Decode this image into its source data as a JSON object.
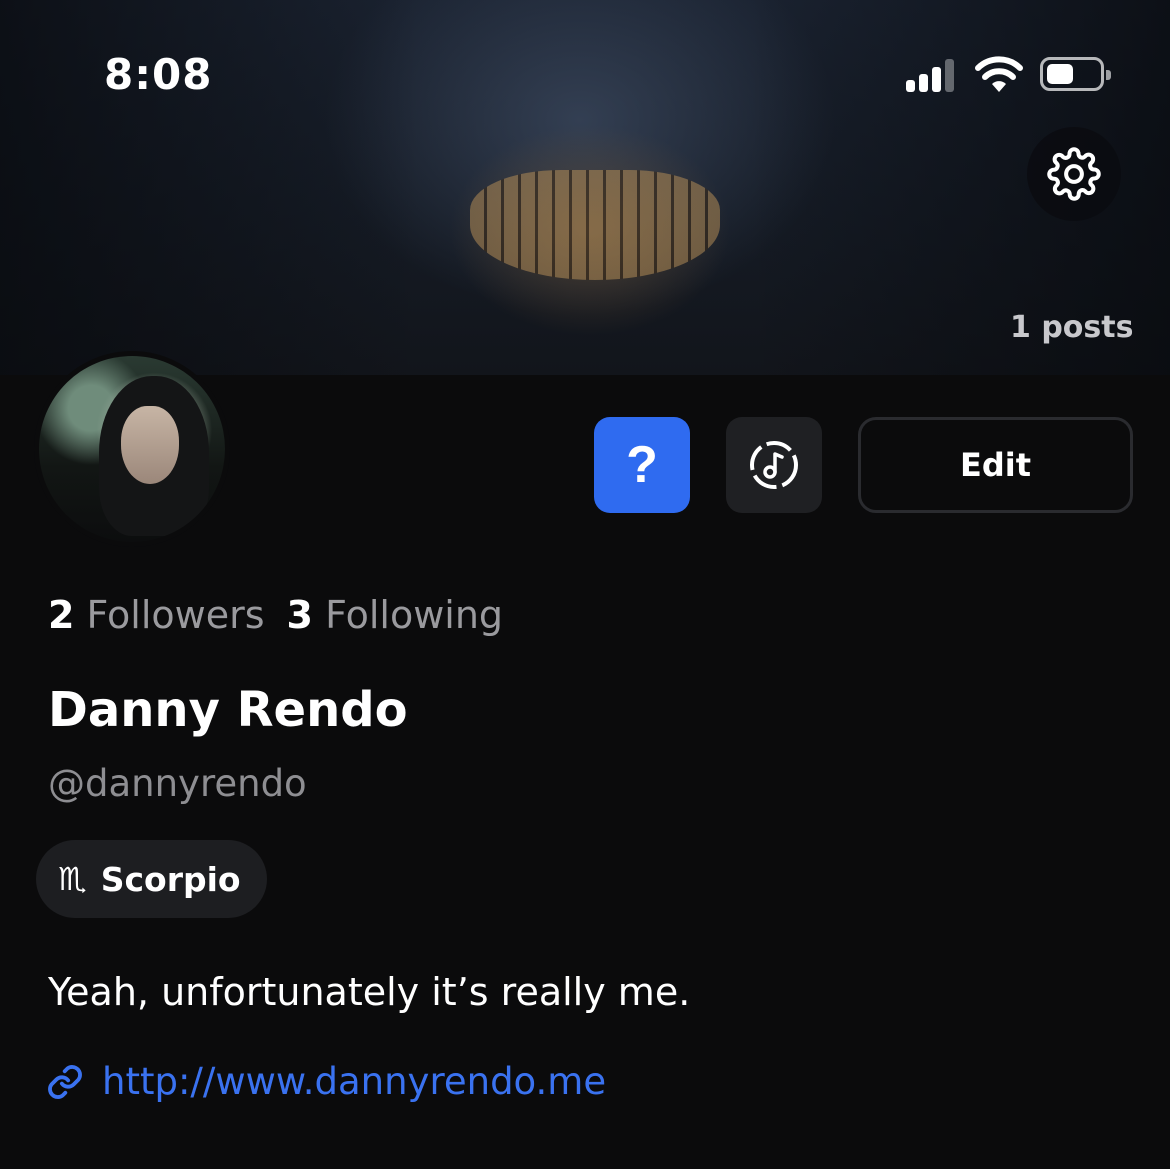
{
  "status_bar": {
    "time": "8:08"
  },
  "header": {
    "posts_count": "1 posts"
  },
  "actions": {
    "help_label": "?",
    "edit_label": "Edit"
  },
  "stats": {
    "followers_count": "2",
    "followers_label": "Followers",
    "following_count": "3",
    "following_label": "Following"
  },
  "profile": {
    "display_name": "Danny Rendo",
    "handle": "@dannyrendo",
    "zodiac_symbol": "♏",
    "zodiac_label": "Scorpio",
    "bio": "Yeah, unfortunately it’s really me.",
    "link": "http://www.dannyrendo.me"
  },
  "colors": {
    "accent": "#2f6bf0",
    "link": "#3a72f0",
    "background": "#0b0b0c"
  },
  "icons": [
    "gear-icon",
    "question-icon",
    "music-icon",
    "link-icon",
    "cellular-signal-icon",
    "wifi-icon",
    "battery-icon"
  ]
}
